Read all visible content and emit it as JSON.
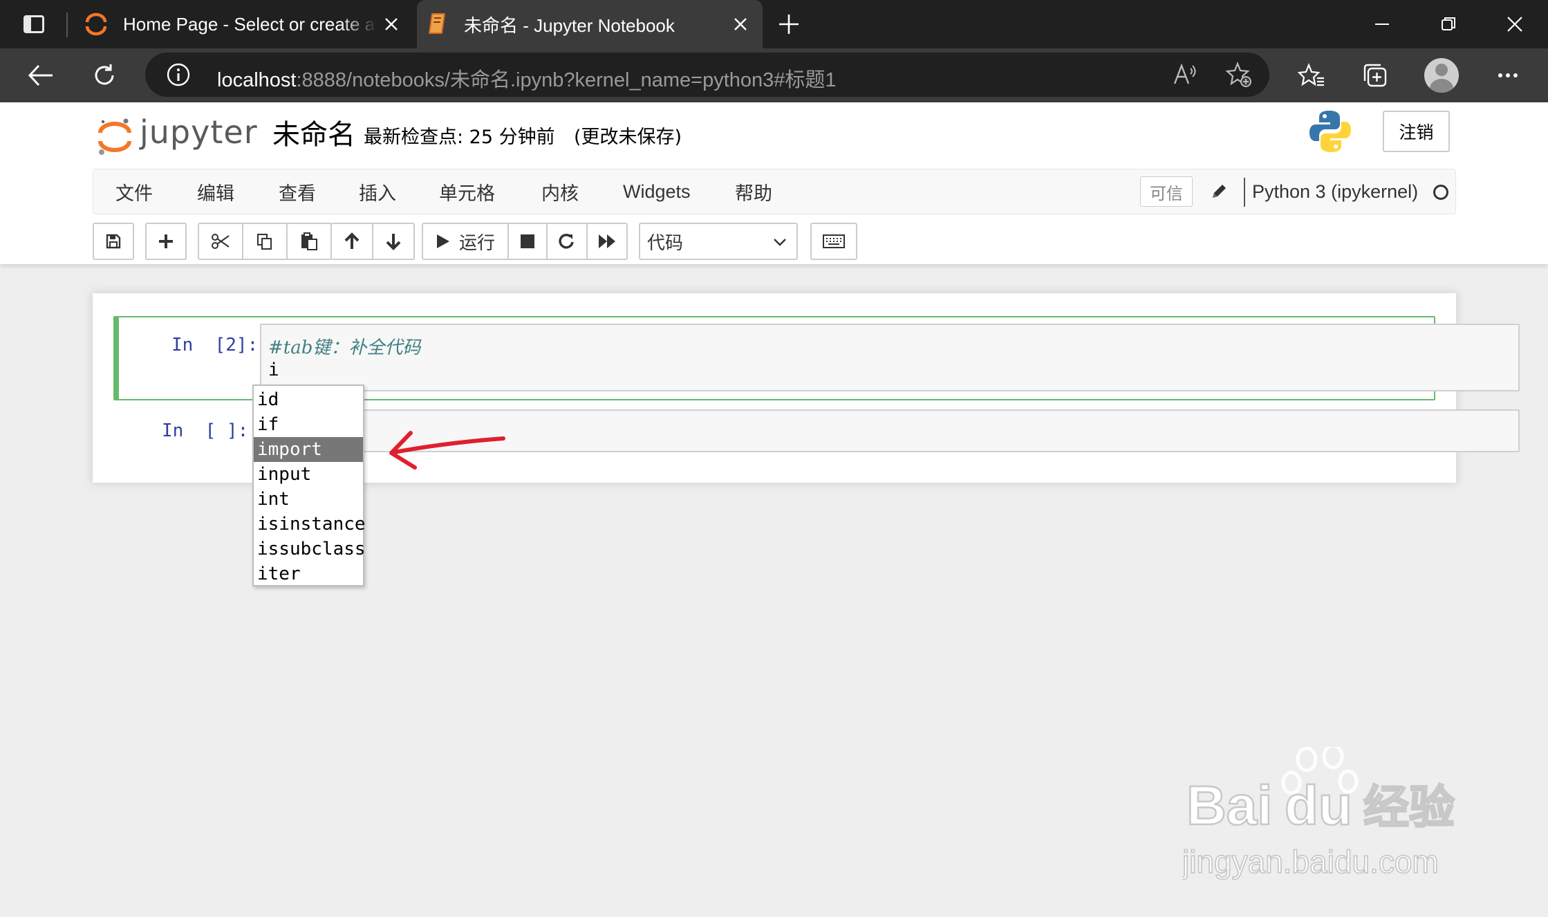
{
  "browser": {
    "tabs": [
      {
        "title": "Home Page - Select or create a n",
        "active": false
      },
      {
        "title": "未命名 - Jupyter Notebook",
        "active": true
      }
    ],
    "url": {
      "host": "localhost",
      "rest": ":8888/notebooks/未命名.ipynb?kernel_name=python3#标题1"
    }
  },
  "jupyter": {
    "logo_text": "jupyter",
    "notebook_name": "未命名",
    "checkpoint": "最新检查点: 25 分钟前",
    "unsaved": "(更改未保存)",
    "logout_label": "注销",
    "menu": [
      "文件",
      "编辑",
      "查看",
      "插入",
      "单元格",
      "内核",
      "Widgets",
      "帮助"
    ],
    "trusted_label": "可信",
    "kernel_name": "Python 3 (ipykernel)",
    "toolbar": {
      "run_label": "运行",
      "cell_type": "代码"
    }
  },
  "cells": [
    {
      "prompt": "In  [2]:",
      "lines": [
        "#tab键：补全代码",
        "i"
      ]
    },
    {
      "prompt": "In  [ ]:",
      "lines": [
        ""
      ]
    }
  ],
  "completion": {
    "options": [
      "id",
      "if",
      "import",
      "input",
      "int",
      "isinstance",
      "issubclass",
      "iter"
    ],
    "selected": "import"
  },
  "annotation": {
    "arrow_color": "#e0202e"
  },
  "watermark": {
    "brand": "Bai",
    "brand2": "du",
    "brand_cn": "经验",
    "site": "jingyan.baidu.com"
  },
  "colors": {
    "tab_bg": "#202020",
    "nav_bg": "#3b3b3b",
    "jupyter_orange": "#f37726",
    "cell_selected": "#66bb6a",
    "prompt": "#303f9f"
  }
}
